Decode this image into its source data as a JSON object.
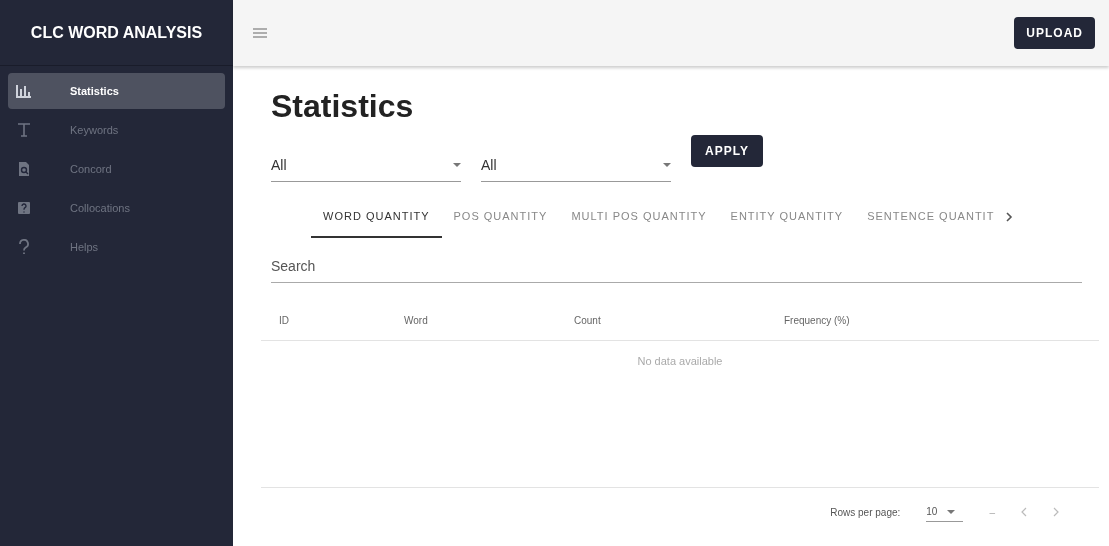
{
  "sidebar": {
    "title": "CLC WORD ANALYSIS",
    "items": [
      {
        "label": "Statistics",
        "selected": true
      },
      {
        "label": "Keywords",
        "selected": false
      },
      {
        "label": "Concord",
        "selected": false
      },
      {
        "label": "Collocations",
        "selected": false
      },
      {
        "label": "Helps",
        "selected": false
      }
    ]
  },
  "toolbar": {
    "upload_button": "UPLOAD"
  },
  "page_title": "Statistics",
  "filters": [
    {
      "value": "All"
    },
    {
      "value": "All"
    }
  ],
  "apply_button": "APPLY",
  "tabs": [
    {
      "label": "WORD QUANTITY",
      "selected": true
    },
    {
      "label": "POS QUANTITY",
      "selected": false
    },
    {
      "label": "MULTI POS QUANTITY",
      "selected": false
    },
    {
      "label": "ENTITY QUANTITY",
      "selected": false
    },
    {
      "label": "SENTENCE QUANTIT",
      "selected": false
    }
  ],
  "search": {
    "placeholder": "Search"
  },
  "table": {
    "columns": [
      "ID",
      "Word",
      "Count",
      "Frequency (%)"
    ],
    "empty_text": "No data available"
  },
  "pagination": {
    "rows_per_page_label": "Rows per page:",
    "rows_per_page": "10",
    "range": "–"
  }
}
